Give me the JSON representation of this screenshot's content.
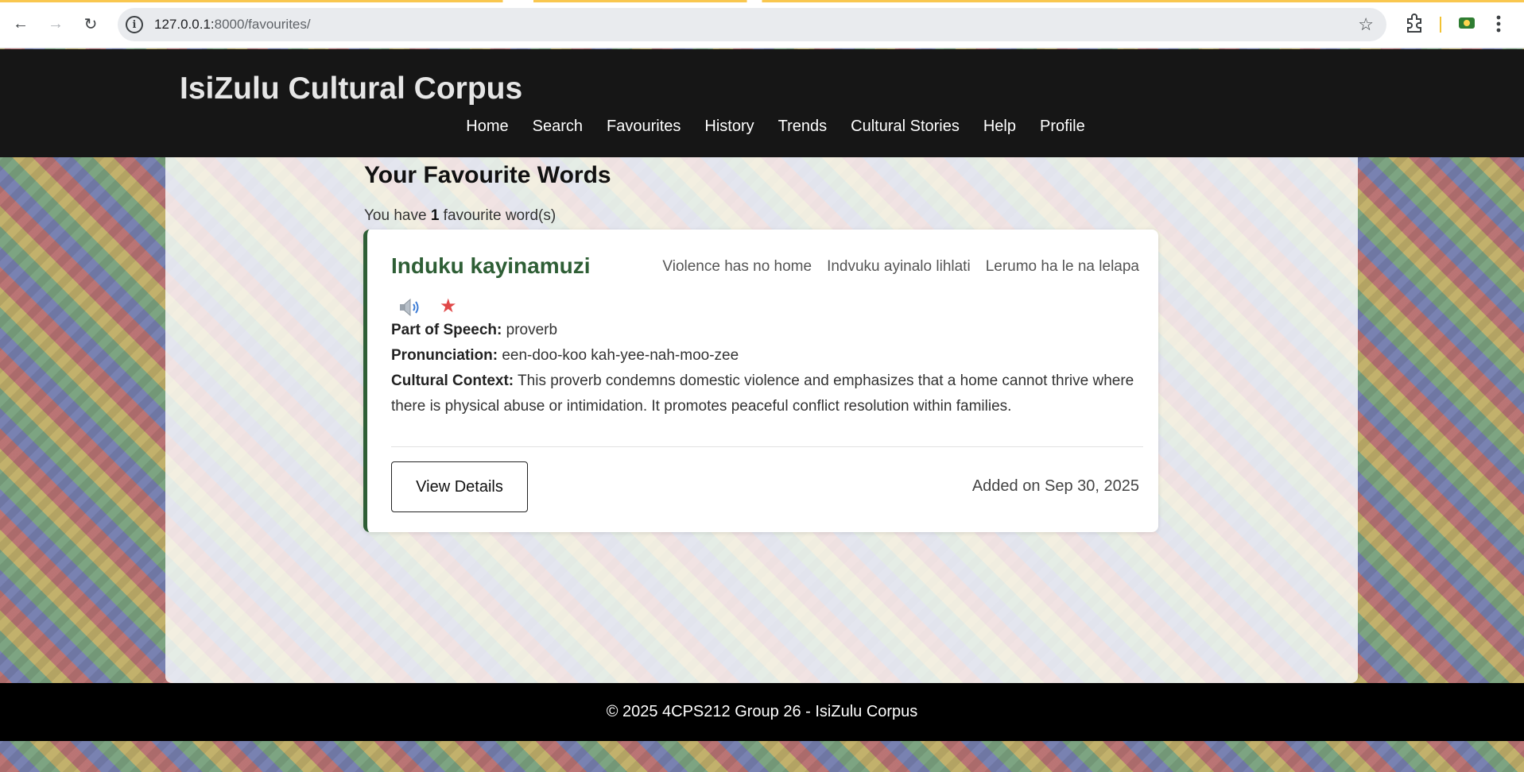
{
  "browser": {
    "url_host": "127.0.0.1:",
    "url_path": "8000/favourites/",
    "back_icon": "←",
    "forward_icon": "→",
    "reload_icon": "↻",
    "info_icon": "i",
    "bookmark_icon": "☆"
  },
  "site": {
    "title": "IsiZulu Cultural Corpus",
    "nav": [
      "Home",
      "Search",
      "Favourites",
      "History",
      "Trends",
      "Cultural Stories",
      "Help",
      "Profile"
    ]
  },
  "page": {
    "heading": "Your Favourite Words",
    "count_prefix": "You have ",
    "count_value": "1",
    "count_suffix": " favourite word(s)"
  },
  "favourite": {
    "word": "Induku kayinamuzi",
    "translations": [
      "Violence has no home",
      "Indvuku ayinalo lihlati",
      "Lerumo ha le na lelapa"
    ],
    "star_icon": "★",
    "part_of_speech_label": "Part of Speech:",
    "part_of_speech": " proverb",
    "pronunciation_label": "Pronunciation:",
    "pronunciation": " een-doo-koo kah-yee-nah-moo-zee",
    "cultural_context_label": "Cultural Context:",
    "cultural_context": " This proverb condemns domestic violence and emphasizes that a home cannot thrive where there is physical abuse or intimidation. It promotes peaceful conflict resolution within families.",
    "view_details_label": "View Details",
    "added_on": "Added on Sep 30, 2025"
  },
  "footer": {
    "text": "© 2025 4CPS212 Group 26 - IsiZulu Corpus"
  },
  "colors": {
    "header_bg": "#161616",
    "word_green": "#2e5e35",
    "star_red": "#e04848",
    "footer_bg": "#000000"
  }
}
